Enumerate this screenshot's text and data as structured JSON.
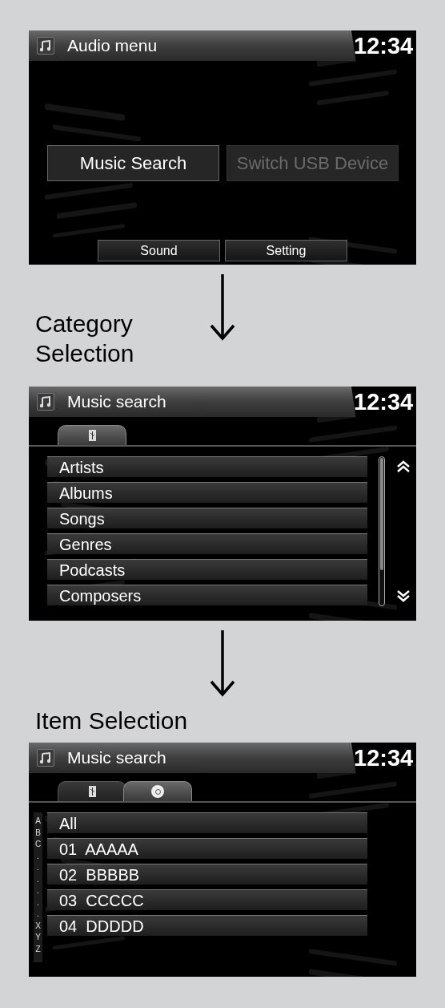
{
  "steps": [
    {
      "screen": {
        "kind": "menu",
        "title": "Audio menu",
        "clock": "12:34",
        "buttons": [
          {
            "label": "Music Search",
            "disabled": false
          },
          {
            "label": "Switch USB Device",
            "disabled": true
          }
        ],
        "bottom_buttons": [
          "Sound",
          "Setting"
        ]
      }
    },
    {
      "caption": "Category Selection",
      "screen": {
        "kind": "list",
        "title": "Music search",
        "clock": "12:34",
        "tabs": [
          {
            "kind": "usb",
            "selected": true
          }
        ],
        "items": [
          "Artists",
          "Albums",
          "Songs",
          "Genres",
          "Podcasts",
          "Composers"
        ],
        "scrollable": true
      }
    },
    {
      "caption": "Item Selection",
      "screen": {
        "kind": "list",
        "title": "Music search",
        "clock": "12:34",
        "tabs": [
          {
            "kind": "usb",
            "selected": false
          },
          {
            "kind": "disc",
            "selected": true
          }
        ],
        "index": [
          "A",
          "B",
          "C",
          ".",
          ".",
          ".",
          ".",
          ".",
          ".",
          "X",
          "Y",
          "Z"
        ],
        "items": [
          "All",
          "01  AAAAA",
          "02  BBBBB",
          "03  CCCCC",
          "04  DDDDD"
        ]
      }
    }
  ]
}
